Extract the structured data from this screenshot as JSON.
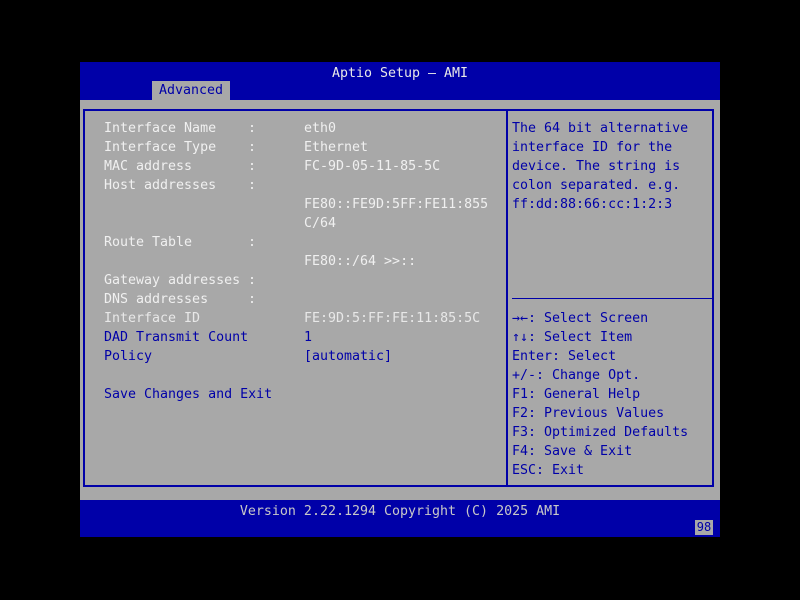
{
  "header": {
    "title": "Aptio Setup – AMI",
    "tab": "Advanced"
  },
  "rows": {
    "interface_name": {
      "label": "Interface Name",
      "sep": ":",
      "value": "eth0"
    },
    "interface_type": {
      "label": "Interface Type",
      "sep": ":",
      "value": "Ethernet"
    },
    "mac_address": {
      "label": "MAC address",
      "sep": ":",
      "value": "FC-9D-05-11-85-5C"
    },
    "host_addresses": {
      "label": "Host addresses",
      "sep": ":",
      "value_line1": "FE80::FE9D:5FF:FE11:855",
      "value_line2": "C/64"
    },
    "route_table": {
      "label": "Route Table",
      "sep": ":",
      "value": "FE80::/64 >>::"
    },
    "gateway_addresses": {
      "label": "Gateway addresses",
      "sep": ":"
    },
    "dns_addresses": {
      "label": "DNS addresses",
      "sep": ":"
    },
    "interface_id": {
      "label": "Interface ID",
      "value": "FE:9D:5:FF:FE:11:85:5C"
    },
    "dad_transmit_count": {
      "label": "DAD Transmit Count",
      "value": "1"
    },
    "policy": {
      "label": "Policy",
      "value": "[automatic]"
    },
    "save_exit": {
      "label": "Save Changes and Exit"
    }
  },
  "help": {
    "description": [
      "The 64 bit alternative",
      "interface ID for the",
      "device. The string is",
      "colon separated. e.g.",
      "ff:dd:88:66:cc:1:2:3"
    ],
    "keys": [
      "→←: Select Screen",
      "↑↓: Select Item",
      "Enter: Select",
      "+/-: Change Opt.",
      "F1: General Help",
      "F2: Previous Values",
      "F3: Optimized Defaults",
      "F4: Save & Exit",
      "ESC: Exit"
    ]
  },
  "footer": {
    "version": "Version 2.22.1294 Copyright (C) 2025 AMI",
    "badge": "98"
  },
  "colors": {
    "bios_blue": "#0000a8",
    "panel_gray": "#a8a8a8",
    "text_white": "#f0f0f0"
  }
}
